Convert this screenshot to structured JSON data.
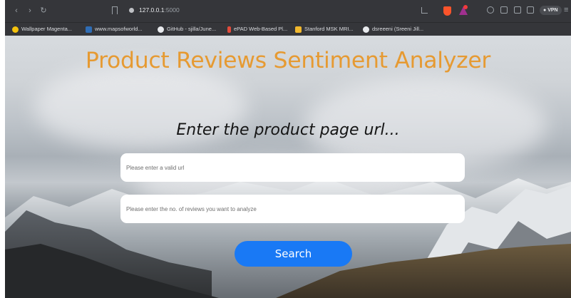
{
  "browser": {
    "back_icon": "chevron-left-icon",
    "forward_icon": "chevron-right-icon",
    "reload_icon": "reload-icon",
    "url_host": "127.0.0.1",
    "url_port": ":5000",
    "vpn_label": "VPN",
    "menu_icon": "hamburger-menu-icon"
  },
  "bookmarks": [
    {
      "label": "Wallpaper Magenta...",
      "icon": "bulb-icon",
      "color": "#f4c20d"
    },
    {
      "label": "www.mapsofworld...",
      "icon": "maps-icon",
      "color": "#2f6db5"
    },
    {
      "label": "GitHub - sjilla/June...",
      "icon": "github-icon",
      "color": "#e8eaed"
    },
    {
      "label": "ePAD Web-Based Pl...",
      "icon": "epad-icon",
      "color": "#e24b3b"
    },
    {
      "label": "Stanford MSK MRI...",
      "icon": "stanford-icon",
      "color": "#f1b82d"
    },
    {
      "label": "dsreeeni (Sreeni Jill...",
      "icon": "github-icon",
      "color": "#e8eaed"
    }
  ],
  "page": {
    "title": "Product Reviews Sentiment Analyzer",
    "prompt": "Enter the product page url...",
    "url_placeholder": "Please enter a valid url",
    "count_placeholder": "Please enter the no. of reviews you want to analyze",
    "search_label": "Search"
  },
  "colors": {
    "title": "#e69a32",
    "button": "#1979f5",
    "shield": "#fb542b"
  }
}
